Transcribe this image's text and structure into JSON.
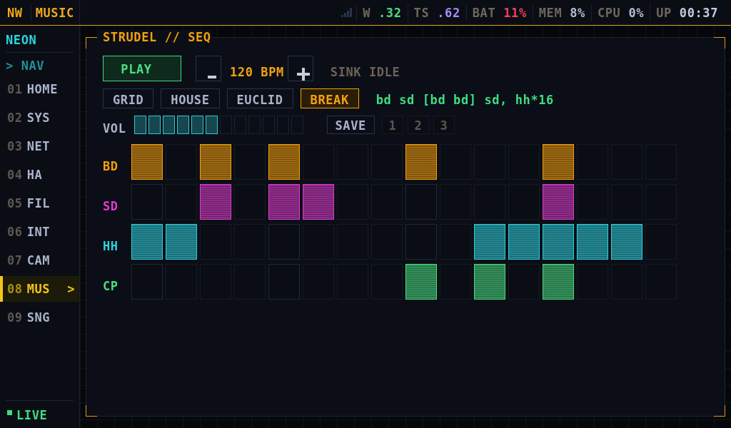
{
  "top_bar": {
    "brand": "NW",
    "app": "MUSIC",
    "stats": [
      {
        "label": "W",
        "value": ".32",
        "color": "#4ade80"
      },
      {
        "label": "TS",
        "value": ".62",
        "color": "#a78bfa"
      },
      {
        "label": "BAT",
        "value": "11%",
        "color": "#f43f5e"
      },
      {
        "label": "MEM",
        "value": "8%",
        "color": "#b4bcd4"
      },
      {
        "label": "CPU",
        "value": "0%",
        "color": "#b4bcd4"
      },
      {
        "label": "UP",
        "value": "00:37",
        "color": "#c4cce0"
      }
    ]
  },
  "sidebar": {
    "title": "NEON",
    "section": "> NAV",
    "items": [
      {
        "number": "01",
        "label": "HOME",
        "selected": false
      },
      {
        "number": "02",
        "label": "SYS",
        "selected": false
      },
      {
        "number": "03",
        "label": "NET",
        "selected": false
      },
      {
        "number": "04",
        "label": "HA",
        "selected": false
      },
      {
        "number": "05",
        "label": "FIL",
        "selected": false
      },
      {
        "number": "06",
        "label": "INT",
        "selected": false
      },
      {
        "number": "07",
        "label": "CAM",
        "selected": false
      },
      {
        "number": "08",
        "label": "MUS",
        "selected": true,
        "indicator": ">"
      },
      {
        "number": "09",
        "label": "SNG",
        "selected": false
      }
    ],
    "status": "LIVE"
  },
  "panel": {
    "title": "STRUDEL // SEQ",
    "play": "PLAY",
    "tempo": "120 BPM",
    "sink": "SINK IDLE",
    "patterns": [
      {
        "label": "GRID",
        "selected": false
      },
      {
        "label": "HOUSE",
        "selected": false
      },
      {
        "label": "EUCLID",
        "selected": false
      },
      {
        "label": "BREAK",
        "selected": true
      }
    ],
    "pattern_code": "bd sd [bd bd] sd, hh*16",
    "volume": {
      "label": "VOL",
      "level": 0.5
    },
    "save": "SAVE",
    "slots": [
      "1",
      "2",
      "3"
    ],
    "tracks": [
      {
        "name": "BD",
        "color": "#f59e0b",
        "steps": [
          {
            "on": true
          },
          {
            "on": false
          },
          {
            "on": true
          },
          {
            "on": false
          },
          {
            "on": true
          },
          {
            "on": false
          },
          {
            "on": false
          },
          {
            "on": false
          },
          {
            "on": true
          },
          {
            "on": false
          },
          {
            "on": false
          },
          {
            "on": false
          },
          {
            "on": true
          },
          {
            "on": false
          },
          {
            "on": false
          },
          {
            "on": false
          }
        ]
      },
      {
        "name": "SD",
        "color": "#e03ccf",
        "steps": [
          {
            "on": false
          },
          {
            "on": false
          },
          {
            "on": true
          },
          {
            "on": false
          },
          {
            "on": true
          },
          {
            "on": true
          },
          {
            "on": false
          },
          {
            "on": false
          },
          {
            "on": false
          },
          {
            "on": false
          },
          {
            "on": false
          },
          {
            "on": false
          },
          {
            "on": true
          },
          {
            "on": false
          },
          {
            "on": false
          },
          {
            "on": false
          }
        ]
      },
      {
        "name": "HH",
        "color": "#2fd0dc",
        "steps": [
          {
            "on": true
          },
          {
            "on": true
          },
          {
            "on": false
          },
          {
            "on": false
          },
          {
            "on": false
          },
          {
            "on": false
          },
          {
            "on": false
          },
          {
            "on": false
          },
          {
            "on": false
          },
          {
            "on": false
          },
          {
            "on": true
          },
          {
            "on": true
          },
          {
            "on": true
          },
          {
            "on": true
          },
          {
            "on": true
          },
          {
            "on": false
          }
        ]
      },
      {
        "name": "CP",
        "color": "#4ade80",
        "steps": [
          {
            "on": false
          },
          {
            "on": false
          },
          {
            "on": false
          },
          {
            "on": false
          },
          {
            "on": false
          },
          {
            "on": false
          },
          {
            "on": false
          },
          {
            "on": false
          },
          {
            "on": true
          },
          {
            "on": false
          },
          {
            "on": true
          },
          {
            "on": false
          },
          {
            "on": true
          },
          {
            "on": false
          },
          {
            "on": false
          },
          {
            "on": false
          }
        ]
      }
    ]
  }
}
